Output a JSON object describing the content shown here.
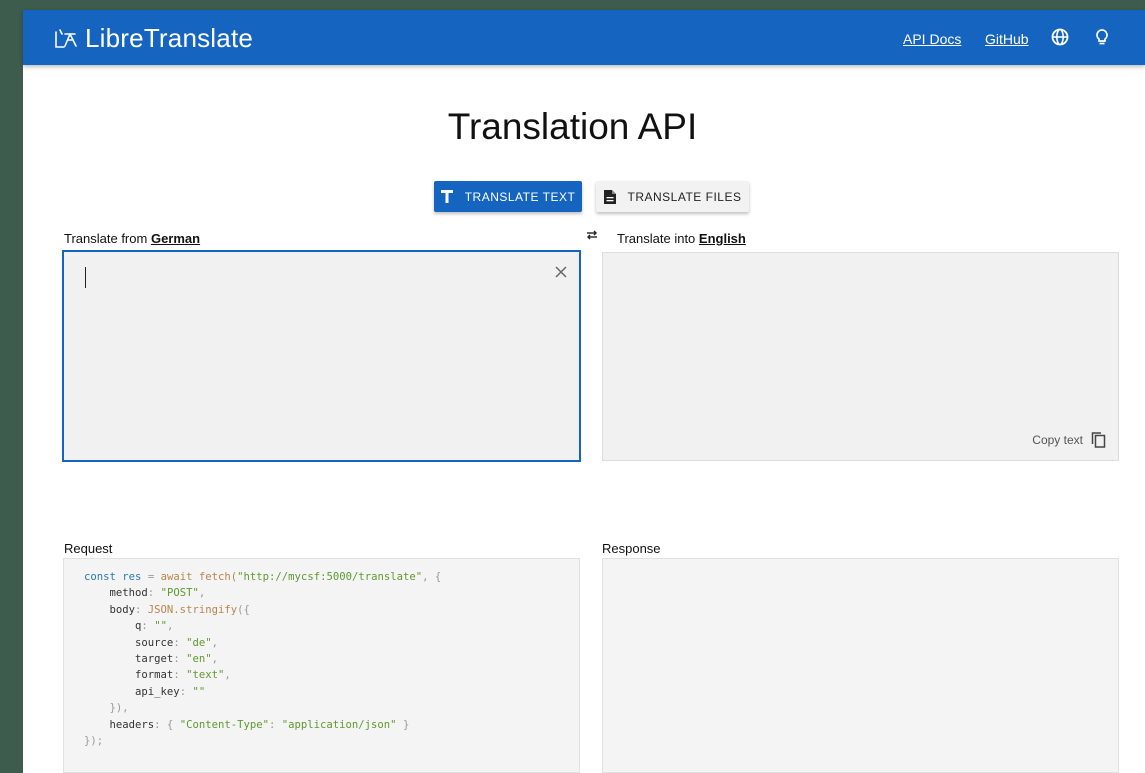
{
  "navbar": {
    "brand": "LibreTranslate",
    "links": [
      "API Docs",
      "GitHub"
    ],
    "icons": [
      "globe-icon",
      "lightbulb-icon"
    ],
    "color": "#1565c0"
  },
  "page": {
    "title": "Translation API"
  },
  "modes": {
    "translate_text": "TRANSLATE TEXT",
    "translate_files": "TRANSLATE FILES"
  },
  "source": {
    "label_prefix": "Translate from",
    "language": "German",
    "value": ""
  },
  "target": {
    "label_prefix": "Translate into",
    "language": "English",
    "copy_label": "Copy text"
  },
  "request": {
    "label": "Request",
    "code": {
      "l1": [
        "const",
        "res",
        "=",
        "await",
        "fetch(",
        "\"http://mycsf:5000/translate\"",
        ", {"
      ],
      "method_key": "method",
      "method_val": "\"POST\"",
      "body_key": "body",
      "body_fn": "JSON.stringify",
      "q_key": "q",
      "q_val": "\"\"",
      "source_key": "source",
      "source_val": "\"de\"",
      "target_key": "target",
      "target_val": "\"en\"",
      "format_key": "format",
      "format_val": "\"text\"",
      "api_key_key": "api_key",
      "api_key_val": "\"\"",
      "headers_key": "headers",
      "ct_key": "\"Content-Type\"",
      "ct_val": "\"application/json\""
    }
  },
  "response": {
    "label": "Response"
  }
}
